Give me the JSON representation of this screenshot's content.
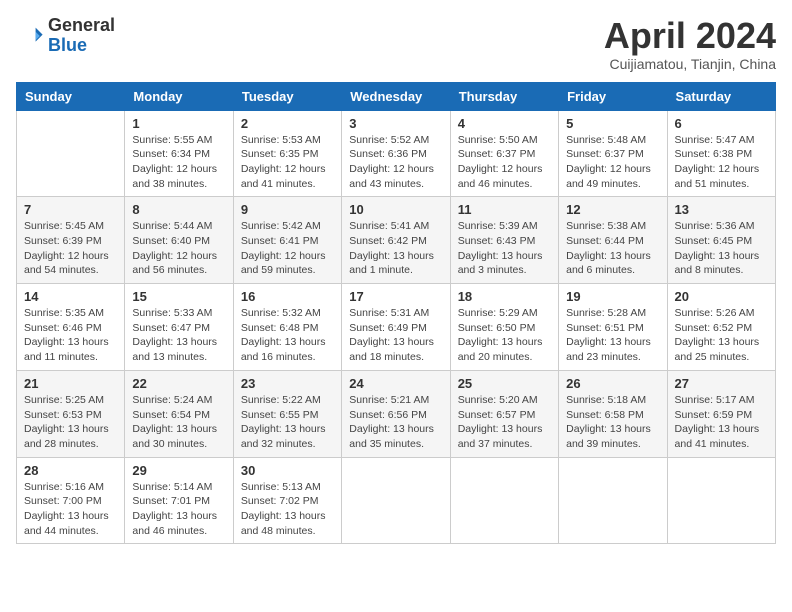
{
  "header": {
    "logo_general": "General",
    "logo_blue": "Blue",
    "month_title": "April 2024",
    "subtitle": "Cuijiamatou, Tianjin, China"
  },
  "weekdays": [
    "Sunday",
    "Monday",
    "Tuesday",
    "Wednesday",
    "Thursday",
    "Friday",
    "Saturday"
  ],
  "weeks": [
    [
      {
        "day": "",
        "text": ""
      },
      {
        "day": "1",
        "text": "Sunrise: 5:55 AM\nSunset: 6:34 PM\nDaylight: 12 hours\nand 38 minutes."
      },
      {
        "day": "2",
        "text": "Sunrise: 5:53 AM\nSunset: 6:35 PM\nDaylight: 12 hours\nand 41 minutes."
      },
      {
        "day": "3",
        "text": "Sunrise: 5:52 AM\nSunset: 6:36 PM\nDaylight: 12 hours\nand 43 minutes."
      },
      {
        "day": "4",
        "text": "Sunrise: 5:50 AM\nSunset: 6:37 PM\nDaylight: 12 hours\nand 46 minutes."
      },
      {
        "day": "5",
        "text": "Sunrise: 5:48 AM\nSunset: 6:37 PM\nDaylight: 12 hours\nand 49 minutes."
      },
      {
        "day": "6",
        "text": "Sunrise: 5:47 AM\nSunset: 6:38 PM\nDaylight: 12 hours\nand 51 minutes."
      }
    ],
    [
      {
        "day": "7",
        "text": "Sunrise: 5:45 AM\nSunset: 6:39 PM\nDaylight: 12 hours\nand 54 minutes."
      },
      {
        "day": "8",
        "text": "Sunrise: 5:44 AM\nSunset: 6:40 PM\nDaylight: 12 hours\nand 56 minutes."
      },
      {
        "day": "9",
        "text": "Sunrise: 5:42 AM\nSunset: 6:41 PM\nDaylight: 12 hours\nand 59 minutes."
      },
      {
        "day": "10",
        "text": "Sunrise: 5:41 AM\nSunset: 6:42 PM\nDaylight: 13 hours\nand 1 minute."
      },
      {
        "day": "11",
        "text": "Sunrise: 5:39 AM\nSunset: 6:43 PM\nDaylight: 13 hours\nand 3 minutes."
      },
      {
        "day": "12",
        "text": "Sunrise: 5:38 AM\nSunset: 6:44 PM\nDaylight: 13 hours\nand 6 minutes."
      },
      {
        "day": "13",
        "text": "Sunrise: 5:36 AM\nSunset: 6:45 PM\nDaylight: 13 hours\nand 8 minutes."
      }
    ],
    [
      {
        "day": "14",
        "text": "Sunrise: 5:35 AM\nSunset: 6:46 PM\nDaylight: 13 hours\nand 11 minutes."
      },
      {
        "day": "15",
        "text": "Sunrise: 5:33 AM\nSunset: 6:47 PM\nDaylight: 13 hours\nand 13 minutes."
      },
      {
        "day": "16",
        "text": "Sunrise: 5:32 AM\nSunset: 6:48 PM\nDaylight: 13 hours\nand 16 minutes."
      },
      {
        "day": "17",
        "text": "Sunrise: 5:31 AM\nSunset: 6:49 PM\nDaylight: 13 hours\nand 18 minutes."
      },
      {
        "day": "18",
        "text": "Sunrise: 5:29 AM\nSunset: 6:50 PM\nDaylight: 13 hours\nand 20 minutes."
      },
      {
        "day": "19",
        "text": "Sunrise: 5:28 AM\nSunset: 6:51 PM\nDaylight: 13 hours\nand 23 minutes."
      },
      {
        "day": "20",
        "text": "Sunrise: 5:26 AM\nSunset: 6:52 PM\nDaylight: 13 hours\nand 25 minutes."
      }
    ],
    [
      {
        "day": "21",
        "text": "Sunrise: 5:25 AM\nSunset: 6:53 PM\nDaylight: 13 hours\nand 28 minutes."
      },
      {
        "day": "22",
        "text": "Sunrise: 5:24 AM\nSunset: 6:54 PM\nDaylight: 13 hours\nand 30 minutes."
      },
      {
        "day": "23",
        "text": "Sunrise: 5:22 AM\nSunset: 6:55 PM\nDaylight: 13 hours\nand 32 minutes."
      },
      {
        "day": "24",
        "text": "Sunrise: 5:21 AM\nSunset: 6:56 PM\nDaylight: 13 hours\nand 35 minutes."
      },
      {
        "day": "25",
        "text": "Sunrise: 5:20 AM\nSunset: 6:57 PM\nDaylight: 13 hours\nand 37 minutes."
      },
      {
        "day": "26",
        "text": "Sunrise: 5:18 AM\nSunset: 6:58 PM\nDaylight: 13 hours\nand 39 minutes."
      },
      {
        "day": "27",
        "text": "Sunrise: 5:17 AM\nSunset: 6:59 PM\nDaylight: 13 hours\nand 41 minutes."
      }
    ],
    [
      {
        "day": "28",
        "text": "Sunrise: 5:16 AM\nSunset: 7:00 PM\nDaylight: 13 hours\nand 44 minutes."
      },
      {
        "day": "29",
        "text": "Sunrise: 5:14 AM\nSunset: 7:01 PM\nDaylight: 13 hours\nand 46 minutes."
      },
      {
        "day": "30",
        "text": "Sunrise: 5:13 AM\nSunset: 7:02 PM\nDaylight: 13 hours\nand 48 minutes."
      },
      {
        "day": "",
        "text": ""
      },
      {
        "day": "",
        "text": ""
      },
      {
        "day": "",
        "text": ""
      },
      {
        "day": "",
        "text": ""
      }
    ]
  ]
}
